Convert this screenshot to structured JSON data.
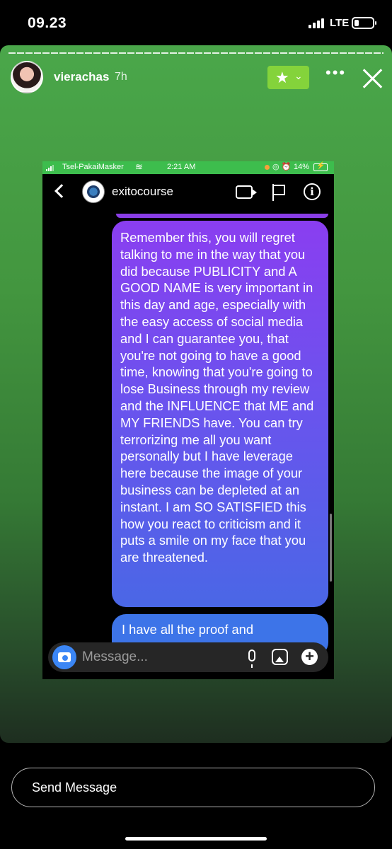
{
  "status_bar": {
    "time": "09.23",
    "network": "LTE",
    "battery_level": 0.25
  },
  "story": {
    "username": "vierachas",
    "time_ago": "7h",
    "close_friends_icon": "star-icon",
    "more_icon": "ellipsis-icon",
    "close_icon": "close-icon",
    "screenshot": {
      "status": {
        "carrier": "Tsel-PakaiMasker",
        "time": "2:21 AM",
        "battery": "14%"
      },
      "chat": {
        "contact_name": "exitocourse",
        "message": "Remember this, you will regret talking to me in the way that you did because PUBLICITY and A GOOD NAME is very important in this day and age, especially with the easy access of social media and I can guarantee you, that you're not going to have a good time, knowing that you're going to lose Business through my review and the INFLUENCE that ME and MY FRIENDS have. You can try terrorizing me all you want personally but I have leverage here because the image of your business can be depleted at an instant. I am SO SATISFIED this how you react to criticism and it puts a smile on my face that you are threatened.",
        "next_message_partial": "I have all the proof and",
        "input_placeholder": "Message..."
      }
    }
  },
  "footer": {
    "send_message_label": "Send Message"
  }
}
